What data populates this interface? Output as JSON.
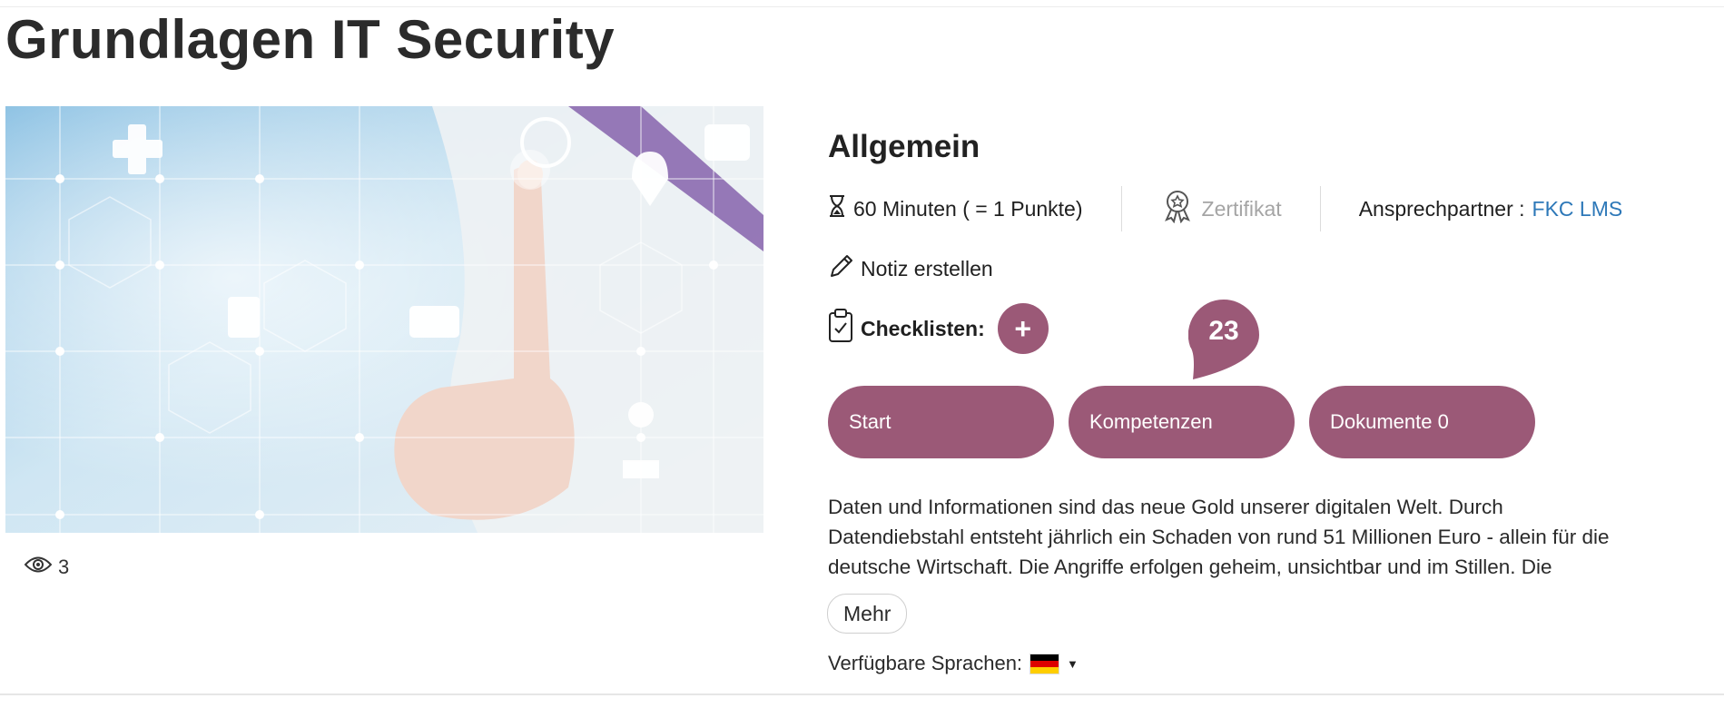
{
  "course": {
    "title": "Grundlagen IT Security",
    "views": "3"
  },
  "details": {
    "section_title": "Allgemein",
    "duration": "60 Minuten ( = 1 Punkte)",
    "certificate": "Zertifikat",
    "contact_label": "Ansprechpartner :",
    "contact_name": "FKC LMS",
    "note_label": "Notiz erstellen",
    "checklists_label": "Checklisten:",
    "badge_count": "23"
  },
  "buttons": {
    "start": "Start",
    "competencies": "Kompetenzen",
    "documents": "Dokumente 0"
  },
  "description": {
    "lines": [
      "Daten und Informationen sind das neue Gold unserer digitalen Welt. Durch",
      "Datendiebstahl entsteht jährlich ein Schaden von rund 51 Millionen Euro - allein für die",
      "deutsche Wirtschaft. Die Angriffe erfolgen geheim, unsichtbar und im Stillen. Die"
    ],
    "more_label": "Mehr"
  },
  "languages": {
    "label": "Verfügbare Sprachen:",
    "selected": "de"
  },
  "colors": {
    "accent": "#9b5977",
    "link": "#2d78b8"
  },
  "icons": {
    "views": "eye-icon",
    "duration": "hourglass-icon",
    "certificate": "award-ribbon-icon",
    "note": "pencil-icon",
    "checklist": "clipboard-check-icon",
    "add": "plus-icon",
    "language_dropdown": "caret-down-icon"
  }
}
